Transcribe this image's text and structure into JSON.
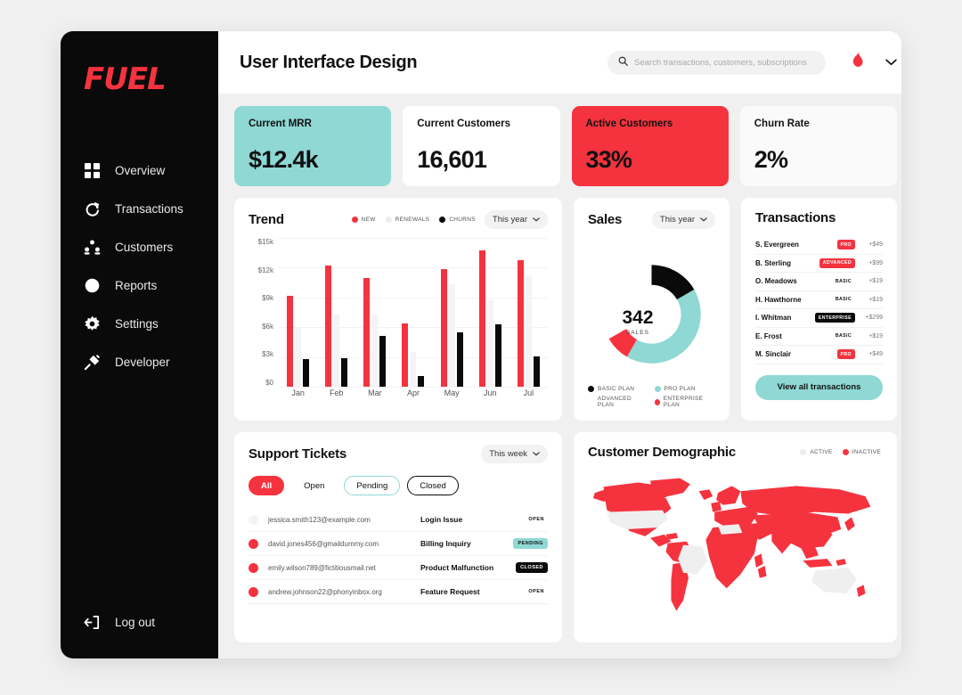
{
  "sidebar": {
    "logo": "FUEL",
    "items": [
      {
        "label": "Overview",
        "icon": "grid-icon"
      },
      {
        "label": "Transactions",
        "icon": "refresh-icon"
      },
      {
        "label": "Customers",
        "icon": "people-icon"
      },
      {
        "label": "Reports",
        "icon": "pie-icon"
      },
      {
        "label": "Settings",
        "icon": "gear-icon"
      },
      {
        "label": "Developer",
        "icon": "plug-icon"
      }
    ],
    "logout": {
      "label": "Log out",
      "icon": "logout-icon"
    }
  },
  "header": {
    "title": "User Interface Design",
    "search_placeholder": "Search transactions, customers, subscriptions",
    "avatar_icon": "flame-icon",
    "chevron_icon": "chevron-down-icon"
  },
  "kpis": [
    {
      "label": "Current MRR",
      "value": "$12.4k",
      "style": "teal"
    },
    {
      "label": "Current Customers",
      "value": "16,601",
      "style": "white"
    },
    {
      "label": "Active Customers",
      "value": "33%",
      "style": "red"
    },
    {
      "label": "Churn Rate",
      "value": "2%",
      "style": "faded"
    }
  ],
  "trend": {
    "title": "Trend",
    "range_label": "This year",
    "legend": [
      {
        "label": "NEW",
        "color": "#f5333f"
      },
      {
        "label": "RENEWALS",
        "color": "#ececec"
      },
      {
        "label": "CHURNS",
        "color": "#0a0a0a"
      }
    ]
  },
  "sales": {
    "title": "Sales",
    "range_label": "This year",
    "total": "342",
    "total_label": "SALES",
    "legend": [
      {
        "label": "BASIC PLAN",
        "color": "#0a0a0a"
      },
      {
        "label": "PRO PLAN",
        "color": "#8fd8d4"
      },
      {
        "label": "ADVANCED PLAN",
        "color": "#ffffff"
      },
      {
        "label": "ENTERPRISE PLAN",
        "color": "#f5333f"
      }
    ]
  },
  "transactions": {
    "title": "Transactions",
    "button_label": "View all transactions",
    "rows": [
      {
        "name": "S. Evergreen",
        "plan": "PRO",
        "plan_style": "pro",
        "amount": "+$49"
      },
      {
        "name": "B. Sterling",
        "plan": "ADVANCED",
        "plan_style": "advanced",
        "amount": "+$99"
      },
      {
        "name": "O. Meadows",
        "plan": "BASIC",
        "plan_style": "basic",
        "amount": "+$19"
      },
      {
        "name": "H. Hawthorne",
        "plan": "BASIC",
        "plan_style": "basic",
        "amount": "+$19"
      },
      {
        "name": "I. Whitman",
        "plan": "ENTERPRISE",
        "plan_style": "enterprise",
        "amount": "+$299"
      },
      {
        "name": "E. Frost",
        "plan": "BASIC",
        "plan_style": "basic",
        "amount": "+$19"
      },
      {
        "name": "M. Sinclair",
        "plan": "PRO",
        "plan_style": "pro",
        "amount": "+$49"
      }
    ]
  },
  "tickets": {
    "title": "Support Tickets",
    "range_label": "This week",
    "filters": [
      {
        "label": "All",
        "style": "active"
      },
      {
        "label": "Open",
        "style": "plain"
      },
      {
        "label": "Pending",
        "style": "outline-teal"
      },
      {
        "label": "Closed",
        "style": "outline-black"
      }
    ],
    "rows": [
      {
        "email": "jessica.smith123@example.com",
        "subject": "Login Issue",
        "status": "OPEN",
        "status_style": "plain",
        "dot": "#f3f3f3"
      },
      {
        "email": "david.jones456@gmaildummy.com",
        "subject": "Billing Inquiry",
        "status": "PENDING",
        "status_style": "pending",
        "dot": "#f5333f"
      },
      {
        "email": "emily.wilson789@fictitiousmail.net",
        "subject": "Product Malfunction",
        "status": "CLOSED",
        "status_style": "closed",
        "dot": "#f5333f"
      },
      {
        "email": "andrew.johnson22@phonyinbox.org",
        "subject": "Feature Request",
        "status": "OPEN",
        "status_style": "plain",
        "dot": "#f5333f"
      }
    ]
  },
  "demographic": {
    "title": "Customer Demographic",
    "legend": [
      {
        "label": "ACTIVE",
        "color": "#ececec"
      },
      {
        "label": "INACTIVE",
        "color": "#f5333f"
      }
    ]
  },
  "chart_data": [
    {
      "type": "bar",
      "title": "Trend",
      "categories": [
        "Jan",
        "Feb",
        "Mar",
        "Apr",
        "May",
        "Jun",
        "Jul"
      ],
      "series": [
        {
          "name": "NEW",
          "color": "#f5333f",
          "values": [
            9.2,
            12.2,
            11.0,
            6.4,
            11.9,
            13.7,
            12.8
          ]
        },
        {
          "name": "RENEWALS",
          "color": "#f4f4f4",
          "values": [
            5.9,
            7.3,
            7.3,
            3.5,
            10.3,
            8.8,
            11.2
          ]
        },
        {
          "name": "CHURNS",
          "color": "#0a0a0a",
          "values": [
            2.8,
            2.9,
            5.1,
            1.1,
            5.5,
            6.3,
            3.1
          ]
        }
      ],
      "xlabel": "",
      "ylabel": "",
      "ylim": [
        0,
        15
      ],
      "ytick_labels": [
        "$15k",
        "$12k",
        "$9k",
        "$6k",
        "$3k",
        "$0"
      ],
      "grid": true,
      "legend_position": "top-right"
    },
    {
      "type": "pie",
      "title": "Sales",
      "center_value": "342",
      "center_label": "SALES",
      "labels": [
        "BASIC PLAN",
        "PRO PLAN",
        "ENTERPRISE PLAN",
        "ADVANCED PLAN"
      ],
      "colors": [
        "#0a0a0a",
        "#8fd8d4",
        "#f5333f",
        "#ffffff"
      ],
      "values": [
        22,
        46,
        9,
        23
      ],
      "legend_position": "bottom"
    }
  ]
}
